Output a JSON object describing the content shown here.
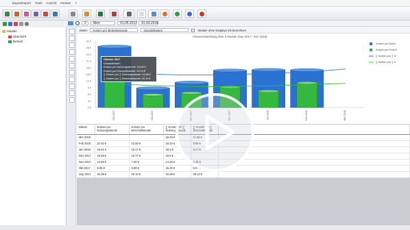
{
  "menu": [
    "Export/Import",
    "Tools",
    "Ansicht",
    "Fenster",
    "?"
  ],
  "toolbar2": {
    "zoom_value": "2",
    "unit_select": "Mon",
    "date_from": "01.05.2017",
    "date_to": "31.03.2018"
  },
  "tree": {
    "root": "Module",
    "items": [
      "Ubersicht",
      "Betrieb"
    ]
  },
  "options": {
    "view_label": "Daten",
    "cost_select": "Kosten pro Betriebsstunde",
    "total_select": "Gesamtkosten",
    "checkbox_label": "Module ohne Displays mit berechnen"
  },
  "chart_data": {
    "type": "bar",
    "title": "Finanzentwicklung über 2 Module (Sep 2017 - Mrz 2018)",
    "categories": [
      "Okt 2017",
      "Okt 2017",
      "Nov 2017",
      "Dez 2017",
      "Jan 2018",
      "Feb 2018",
      "Mrz 2018"
    ],
    "ytick_labels": [
      "32.0",
      "28.0",
      "24.0",
      "21.0",
      "18.0",
      "15.0",
      "12.0",
      "9.0",
      "6.0",
      "3.0",
      "0.0"
    ],
    "ylim": [
      0,
      33
    ],
    "series": [
      {
        "name": "Kosten pro Nutzung",
        "color": "#2a72d2",
        "values": [
          30.3,
          9.6,
          12.4,
          18.4,
          18.7,
          18.6,
          0
        ]
      },
      {
        "name": "Kosten pro Einschaltstunde",
        "color": "#35b83f",
        "values": [
          17.5,
          6.3,
          7.2,
          10.2,
          8.1,
          12.2,
          0
        ]
      }
    ],
    "lines": [
      {
        "name": "Kosten pro ∑ Nutzung",
        "color": "#2a72d2",
        "values": [
          18.2,
          16.5,
          16.1,
          16.3,
          16.9,
          17.6,
          19.1
        ]
      },
      {
        "name": "Kosten pro ∑ Einschaltung",
        "color": "#35b83f",
        "values": [
          11.8,
          10.9,
          10.4,
          10.4,
          10.7,
          11.4,
          12.0
        ]
      }
    ],
    "legend": [
      "Kosten pro Nutzu",
      "Kosten pro Einsch",
      "∑ Kosten pro ∑ N",
      "∑ Kosten pro ∑ E"
    ],
    "legend_position": "right",
    "grid": false
  },
  "tooltip": {
    "title": "Oktober 2017",
    "sub": "Gesamtkosten",
    "lines": [
      "Kosten pro Nutzungsstunde: 34,58 €",
      "Kosten pro Einschaltstunde: 20,10 €",
      "∑ Kosten pro ∑ Nutzungsstunde: 34,58 €",
      "∑ Kosten pro ∑ Einschaltstunde: 20,10 €"
    ]
  },
  "table": {
    "headers": [
      "Datum",
      "Kosten pro Nutzungsstunde",
      "Kosten pro Einschaltstunde",
      "∑ Kosten pro ∑ Nutzungsstunde",
      "∑ Kosten pro ∑ Einschaltstunde"
    ],
    "rows": [
      [
        "Mrz 2018",
        "",
        "",
        "18.49 €",
        "11.05 €"
      ],
      [
        "Feb 2018",
        "21.52 €",
        "12.50 €",
        "18.34 €",
        "9.59 €"
      ],
      [
        "Jan 2018",
        "16.91 €",
        "10.17 €",
        "18.3 €",
        "9.17 €"
      ],
      [
        "Dez 2017",
        "18.29 €",
        "10.77 €",
        "18.5 €",
        ""
      ],
      [
        "Nov 2017",
        "12.55 €",
        "7.40 €",
        "14.29 €",
        "8.46 €"
      ],
      [
        "Okt 2017",
        "8.95 €",
        "5.89 €",
        "15.30 €",
        "9.07 €"
      ],
      [
        "Sep 2017",
        "34.28 €",
        "20.10 €",
        "34.28 €",
        "20.10 €"
      ]
    ]
  }
}
